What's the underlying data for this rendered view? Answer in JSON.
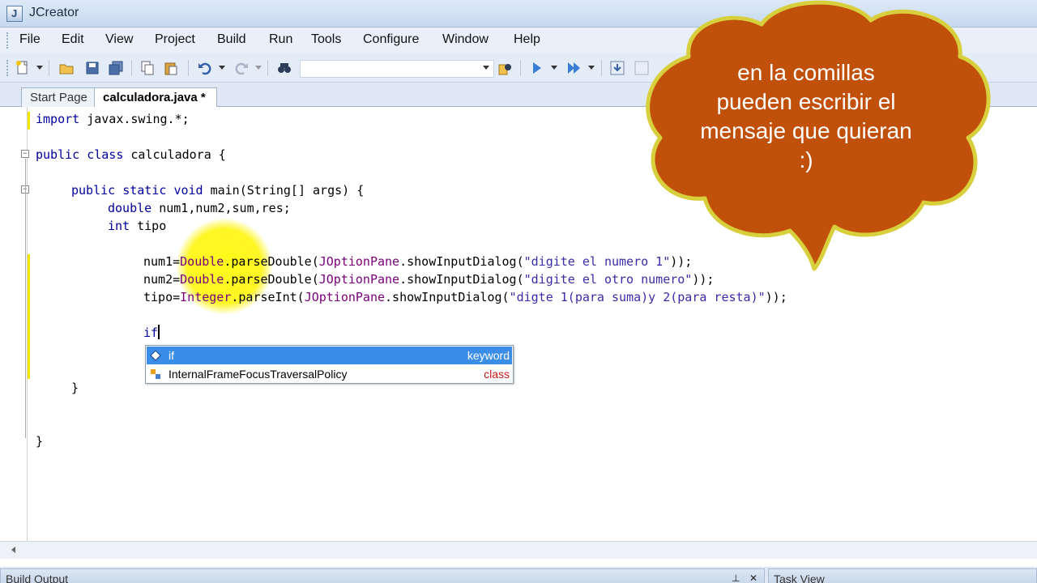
{
  "window": {
    "title": "JCreator"
  },
  "menu": [
    "File",
    "Edit",
    "View",
    "Project",
    "Build",
    "Run",
    "Tools",
    "Configure",
    "Window",
    "Help"
  ],
  "tabs": [
    {
      "label": "Start Page",
      "active": false
    },
    {
      "label": "calculadora.java *",
      "active": true
    }
  ],
  "code": {
    "l1": {
      "kw": "import",
      "rest": " javax.swing.*;"
    },
    "l2": {
      "kw1": "public",
      "kw2": "class",
      "rest": " calculadora {"
    },
    "l3": {
      "kw1": "public",
      "kw2": "static",
      "kw3": "void",
      "rest": " main(String[] args) {"
    },
    "l4": {
      "kw": "double",
      "rest": " num1,num2,sum,res;"
    },
    "l5": {
      "kw": "int",
      "rest": " tipo"
    },
    "l6": {
      "a": "num1=",
      "b": "Double",
      "c": ".parseDouble(",
      "d": "JOptionPane",
      "e": ".showInputDialog(",
      "s": "\"digite el numero 1\"",
      "f": "));"
    },
    "l7": {
      "a": "num2=",
      "b": "Double",
      "c": ".parseDouble(",
      "d": "JOptionPane",
      "e": ".showInputDialog(",
      "s": "\"digite el otro numero\"",
      "f": "));"
    },
    "l8": {
      "a": "tipo=",
      "b": "Integer",
      "c": ".parseInt(",
      "d": "JOptionPane",
      "e": ".showInputDialog(",
      "s": "\"digte 1(para suma)y 2(para resta)\"",
      "f": "));"
    },
    "l9": {
      "text": "if"
    },
    "l10": {
      "text": "}"
    },
    "l11": {
      "text": "}"
    }
  },
  "autocomplete": {
    "items": [
      {
        "name": "if",
        "kind": "keyword",
        "icon": "keyword-icon"
      },
      {
        "name": "InternalFrameFocusTraversalPolicy",
        "kind": "class",
        "icon": "class-icon"
      }
    ]
  },
  "bottom_panels": {
    "build_output": "Build Output",
    "task_view": "Task View"
  },
  "annotation": {
    "lines": [
      "en la comillas",
      "pueden escribir el",
      "mensaje que quieran",
      ":)"
    ]
  },
  "colors": {
    "cloud_fill": "#c0500a",
    "cloud_border": "#d8cf3c",
    "selection": "#3b8ee8",
    "keyword": "#00009c"
  }
}
